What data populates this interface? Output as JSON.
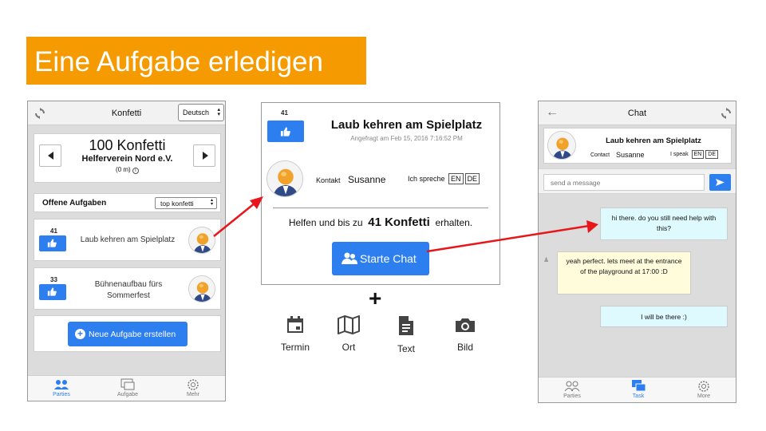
{
  "banner": {
    "title": "Eine Aufgabe erledigen"
  },
  "phone1": {
    "header": {
      "title": "Konfetti",
      "language": "Deutsch"
    },
    "stepper": {
      "amount": "100 Konfetti",
      "org": "Helferverein Nord e.V.",
      "sub": "(0 m)"
    },
    "list_header": {
      "title": "Offene Aufgaben",
      "sort": "top konfetti"
    },
    "tasks": [
      {
        "points": "41",
        "title": "Laub kehren am Spielplatz"
      },
      {
        "points": "33",
        "title": "Bühnenaufbau fürs Sommerfest"
      }
    ],
    "create_button": "Neue Aufgabe erstellen",
    "tabs": [
      {
        "label": "Parties",
        "icon": "parties-icon"
      },
      {
        "label": "Aufgabe",
        "icon": "task-icon"
      },
      {
        "label": "Mehr",
        "icon": "gear-icon"
      }
    ]
  },
  "detail": {
    "points": "41",
    "title": "Laub kehren am Spielplatz",
    "requested": "Angefragt am Feb 15, 2016 7:16:52 PM",
    "contact_label": "Kontakt",
    "contact_name": "Susanne",
    "speaks_label": "Ich spreche",
    "langs": [
      "EN",
      "DE"
    ],
    "reward_prefix": "Helfen und bis zu",
    "reward_amount": "41 Konfetti",
    "reward_suffix": "erhalten.",
    "chat_button": "Starte Chat"
  },
  "plus": "+",
  "attachments": [
    {
      "label": "Termin",
      "icon": "calendar-icon"
    },
    {
      "label": "Ort",
      "icon": "map-icon"
    },
    {
      "label": "Text",
      "icon": "document-icon"
    },
    {
      "label": "Bild",
      "icon": "camera-icon"
    }
  ],
  "phone3": {
    "header": {
      "title": "Chat"
    },
    "task": {
      "title": "Laub kehren am Spielplatz",
      "contact_label": "Contact",
      "contact_name": "Susanne",
      "speaks_label": "I speak",
      "langs": [
        "EN",
        "DE"
      ]
    },
    "input": {
      "placeholder": "send a message"
    },
    "messages": [
      {
        "text": "hi there. do you still need help with this?",
        "side": "right"
      },
      {
        "text": "yeah perfect. lets meet at the entrance of the playground at 17:00 :D",
        "side": "left"
      },
      {
        "text": "I will be there :)",
        "side": "right"
      }
    ],
    "tabs": [
      {
        "label": "Parties",
        "icon": "parties-icon"
      },
      {
        "label": "Task",
        "icon": "chat-icon"
      },
      {
        "label": "More",
        "icon": "gear-icon"
      }
    ]
  },
  "colors": {
    "accent": "#2d7ff0",
    "banner": "#f59a00",
    "arrow": "#e8161a"
  }
}
